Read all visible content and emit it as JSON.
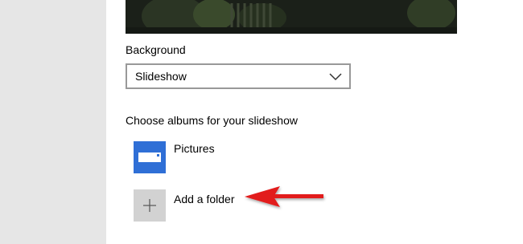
{
  "settings": {
    "background_label": "Background",
    "background_value": "Slideshow",
    "albums_label": "Choose albums for your slideshow",
    "albums": [
      {
        "label": "Pictures",
        "icon": "folder-icon"
      },
      {
        "label": "Add a folder",
        "icon": "plus-icon"
      }
    ]
  },
  "colors": {
    "left_pane": "#e6e6e6",
    "pictures_tile": "#2f6fd6",
    "add_tile": "#d2d2d2",
    "dropdown_border": "#999999",
    "annotation_arrow": "#e21a1a"
  }
}
